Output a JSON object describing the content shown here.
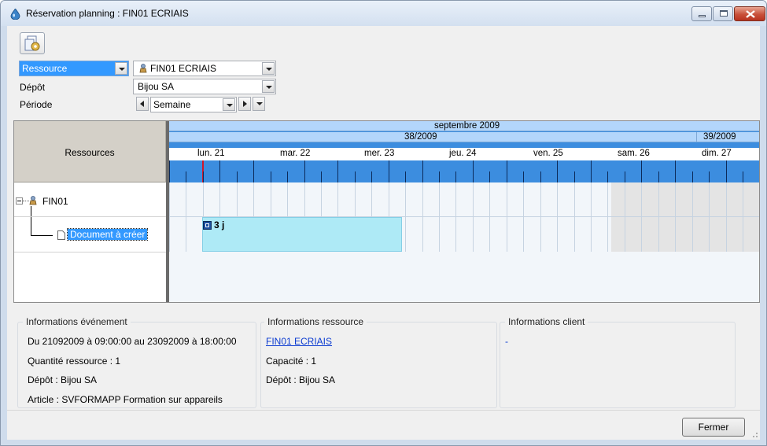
{
  "window": {
    "title": "Réservation planning : FIN01 ECRIAIS"
  },
  "toolbar": {
    "action_icon": "gear-document-icon"
  },
  "filters": {
    "type_value": "Ressource",
    "resource_value": "FIN01 ECRIAIS",
    "depot_label": "Dépôt",
    "depot_value": "Bijou SA",
    "periode_label": "Période",
    "periode_value": "Semaine"
  },
  "planning": {
    "resources_header": "Ressources",
    "month": "septembre 2009",
    "weeks": [
      "38/2009",
      "39/2009"
    ],
    "days": [
      "lun. 21",
      "mar. 22",
      "mer. 23",
      "jeu. 24",
      "ven. 25",
      "sam. 26",
      "dim. 27"
    ],
    "tree": {
      "root": "FIN01",
      "child": "Document à créer"
    },
    "event": {
      "label": "3 j"
    }
  },
  "info_event": {
    "title": "Informations événement",
    "line1": "Du 21092009 à 09:00:00 au 23092009 à 18:00:00",
    "line2": "Quantité ressource : 1",
    "line3": "Dépôt : Bijou SA",
    "line4": "Article : SVFORMAPP Formation sur appareils"
  },
  "info_resource": {
    "title": "Informations ressource",
    "link": "FIN01 ECRIAIS",
    "line2": "Capacité : 1",
    "line3": "Dépôt : Bijou SA"
  },
  "info_client": {
    "title": "Informations client",
    "value": "-"
  },
  "buttons": {
    "close_label": "Fermer"
  },
  "colors": {
    "header_blue": "#3c8ddf",
    "event_cyan": "#aeeaf6",
    "selection": "#3399ff"
  }
}
